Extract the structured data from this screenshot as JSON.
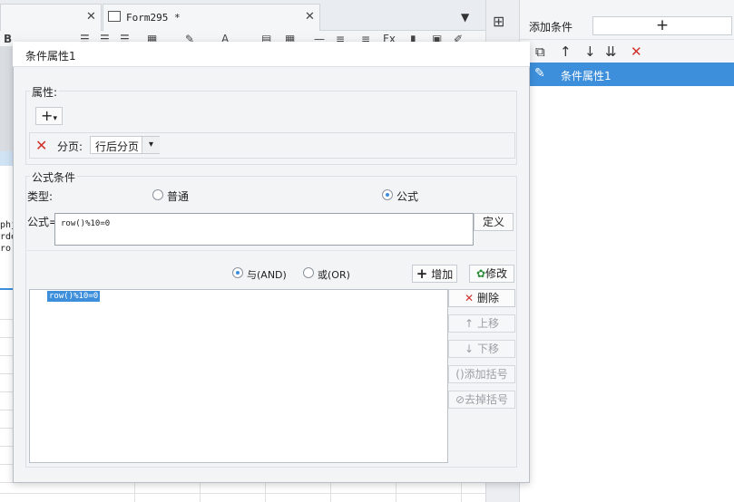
{
  "editor": {
    "tab2_label": "Form295 *",
    "tab_close": "✕",
    "bold_glyph": "B",
    "left_text_lines": [
      "phj",
      "rde",
      "ro"
    ]
  },
  "conditions_panel": {
    "add_condition_label": "添加条件",
    "add_button_glyph": "+",
    "toolbar_icons": [
      "copy-icon",
      "arrow-up-icon",
      "arrow-down-icon",
      "move-bottom-icon",
      "delete-icon"
    ],
    "items": [
      {
        "label": "条件属性1",
        "selected": true
      }
    ]
  },
  "dialog": {
    "title": "条件属性1",
    "properties": {
      "group_label": "属性:",
      "add_glyph": "+",
      "dropdown_glyph": "▾",
      "page_label": "分页:",
      "page_value": "行后分页"
    },
    "formula_condition": {
      "group_label": "公式条件",
      "type_label": "类型:",
      "type_options": [
        "普通",
        "公式"
      ],
      "type_selected": "公式",
      "formula_label": "公式=",
      "formula_value": "row()%10=0",
      "define_button": "定义"
    },
    "logic": {
      "and_label": "与(AND)",
      "or_label": "或(OR)",
      "selected": "and",
      "add_button": "增加",
      "modify_button": "修改"
    },
    "condition_list": [
      "row()%10=0"
    ],
    "side_buttons": {
      "delete": "删除",
      "move_up": "上移",
      "move_down": "下移",
      "add_bracket": "添加括号",
      "remove_bracket": "去掉括号"
    }
  },
  "colors": {
    "accent": "#3d8fdb",
    "delete_red": "#d0312d",
    "dialog_bg": "#f3f4f6"
  }
}
